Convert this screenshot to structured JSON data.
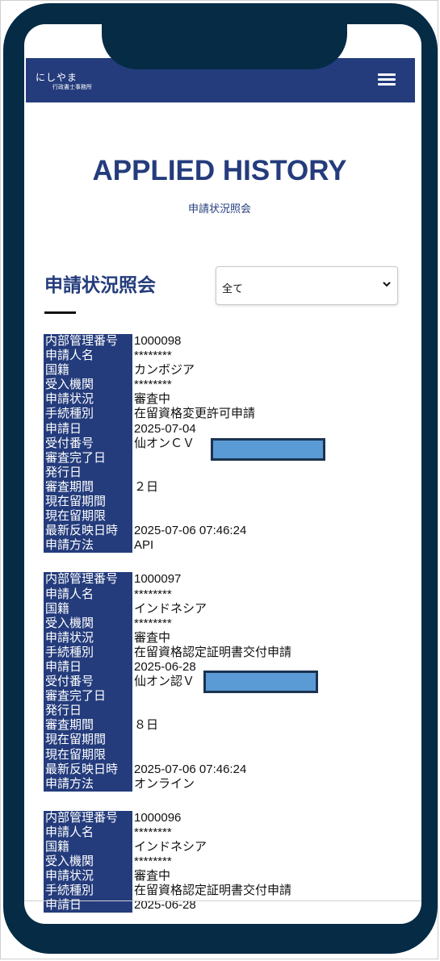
{
  "header": {
    "logo_main": "にしやま",
    "logo_sub": "行政書士事務所",
    "menu_icon": "hamburger-menu-icon"
  },
  "hero": {
    "title": "APPLIED HISTORY",
    "subtitle": "申請状況照会"
  },
  "section": {
    "title": "申請状況照会",
    "filter_selected": "全て"
  },
  "labels": [
    "内部管理番号",
    "申請人名",
    "国籍",
    "受入機関",
    "申請状況",
    "手続種別",
    "申請日",
    "受付番号",
    "審査完了日",
    "発行日",
    "審査期間",
    "現在留期間",
    "現在留期限",
    "最新反映日時",
    "申請方法"
  ],
  "records": [
    {
      "values": [
        "1000098",
        "********",
        "カンボジア",
        "********",
        "審査中",
        "在留資格変更許可申請",
        "2025-07-04",
        "仙オンＣＶ",
        "",
        "",
        "２日",
        "",
        "",
        "2025-07-06 07:46:24",
        "API"
      ]
    },
    {
      "values": [
        "1000097",
        "********",
        "インドネシア",
        "********",
        "審査中",
        "在留資格認定証明書交付申請",
        "2025-06-28",
        "仙オン認Ｖ",
        "",
        "",
        "８日",
        "",
        "",
        "2025-07-06 07:46:24",
        "オンライン"
      ]
    },
    {
      "values": [
        "1000096",
        "********",
        "インドネシア",
        "********",
        "審査中",
        "在留資格認定証明書交付申請",
        "2025-06-28",
        "",
        "",
        "",
        "",
        "",
        "",
        "",
        ""
      ]
    }
  ],
  "colors": {
    "brand_navy": "#243c7c",
    "phone_frame": "#062b45",
    "redaction": "#5b9bd5"
  }
}
